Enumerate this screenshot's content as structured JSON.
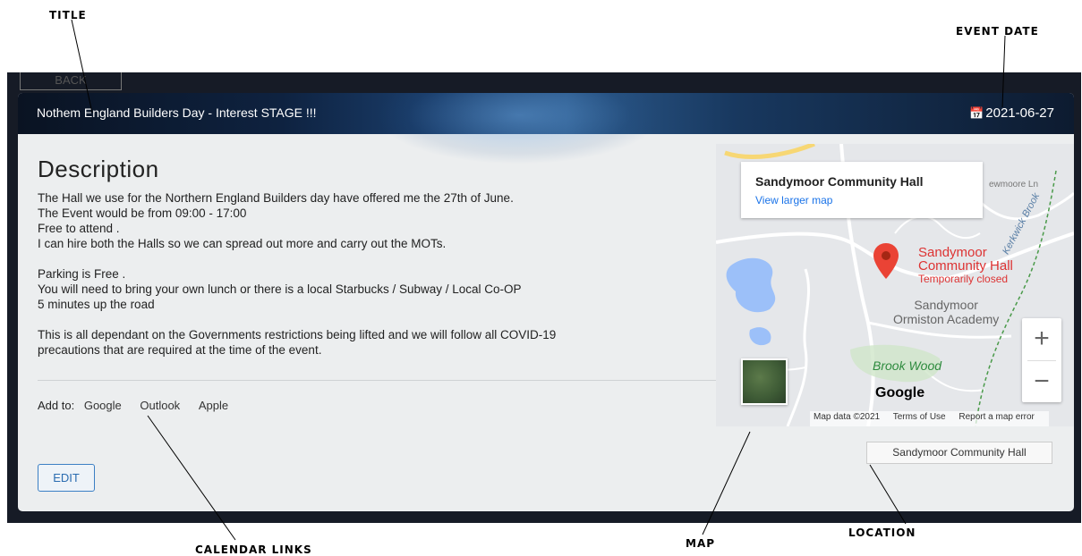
{
  "annotations": {
    "title": "TITLE",
    "event_date": "EVENT DATE",
    "calendar_links": "CALENDAR LINKS",
    "map": "MAP",
    "location": "LOCATION"
  },
  "nav": {
    "back_label": "BACK"
  },
  "event": {
    "title": "Nothem England Builders Day - Interest STAGE !!!",
    "date": "2021-06-27"
  },
  "description": {
    "heading": "Description",
    "paragraphs": [
      [
        "The Hall we use for the Northern England Builders day have offered me the 27th of June.",
        "The Event would be from 09:00 - 17:00",
        "Free to attend .",
        "I can hire both the Halls so we can spread out more and carry out the MOTs."
      ],
      [
        "Parking is Free .",
        "You will need to bring your own lunch or there is a local Starbucks / Subway / Local Co-OP",
        "5 minutes up the road"
      ],
      [
        "This is all dependant on the Governments restrictions being lifted and we will follow all COVID-19",
        "precautions that are required at the time of the event."
      ]
    ]
  },
  "calendar": {
    "label": "Add to:",
    "links": [
      "Google",
      "Outlook",
      "Apple"
    ]
  },
  "edit_label": "EDIT",
  "map": {
    "place_name": "Sandymoor Community Hall",
    "view_larger": "View larger map",
    "pin_title_1": "Sandymoor",
    "pin_title_2": "Community Hall",
    "pin_status": "Temporarily closed",
    "poi_school_1": "Sandymoor",
    "poi_school_2": "Ormiston Academy",
    "poi_wood": "Brook Wood",
    "street_1": "Kerkwick Brook",
    "street_2": "ewmoore Ln",
    "zoom_in": "+",
    "zoom_out": "−",
    "footer": [
      "Map data ©2021",
      "Terms of Use",
      "Report a map error"
    ],
    "brand": "Google"
  },
  "location_label": "Sandymoor Community Hall"
}
